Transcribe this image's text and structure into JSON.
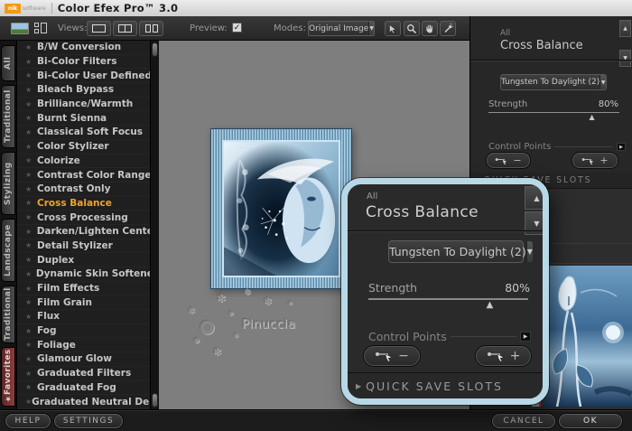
{
  "titlebar": {
    "logo_text": "nik",
    "logo_sub": "software",
    "title": "Color Efex Pro™ 3.0"
  },
  "toolbar": {
    "views_label": "Views:",
    "preview_label": "Preview:",
    "preview_checked": true,
    "modes_label": "Modes:",
    "modes_value": "Original Image",
    "tools": [
      "select",
      "zoom",
      "pan",
      "eyedropper"
    ]
  },
  "sidebar": {
    "tabs": [
      {
        "label": "All",
        "starred": false
      },
      {
        "label": "Traditional",
        "starred": false
      },
      {
        "label": "Stylizing",
        "starred": false
      },
      {
        "label": "Landscape",
        "starred": false
      },
      {
        "label": "Traditional",
        "starred": false
      },
      {
        "label": "Favorites",
        "starred": true
      }
    ],
    "filters": [
      "B/W Conversion",
      "Bi-Color Filters",
      "Bi-Color User Defined",
      "Bleach Bypass",
      "Brilliance/Warmth",
      "Burnt Sienna",
      "Classical Soft Focus",
      "Color Stylizer",
      "Colorize",
      "Contrast Color Range",
      "Contrast Only",
      "Cross Balance",
      "Cross Processing",
      "Darken/Lighten Center",
      "Detail Stylizer",
      "Duplex",
      "Dynamic Skin Softener",
      "Film Effects",
      "Film Grain",
      "Flux",
      "Fog",
      "Foliage",
      "Glamour Glow",
      "Graduated Filters",
      "Graduated Fog",
      "Graduated Neutral Density"
    ],
    "selected_filter": "Cross Balance"
  },
  "filter_panel": {
    "category": "All",
    "title": "Cross Balance",
    "preset": "Tungsten To Daylight (2)",
    "strength_label": "Strength",
    "strength_value": "80%",
    "strength_percent": 80,
    "control_points_label": "Control Points",
    "minus_label": "−",
    "plus_label": "+",
    "quick_save_label": "QUICK SAVE SLOTS"
  },
  "canvas": {
    "watermark": "Pinuccia"
  },
  "footer": {
    "help": "HELP",
    "settings": "SETTINGS",
    "cancel": "CANCEL",
    "ok": "OK"
  },
  "colors": {
    "accent_orange": "#f0a22c",
    "zoom_panel_border": "#b6d8e7",
    "split_line_red": "#cf2d24"
  }
}
